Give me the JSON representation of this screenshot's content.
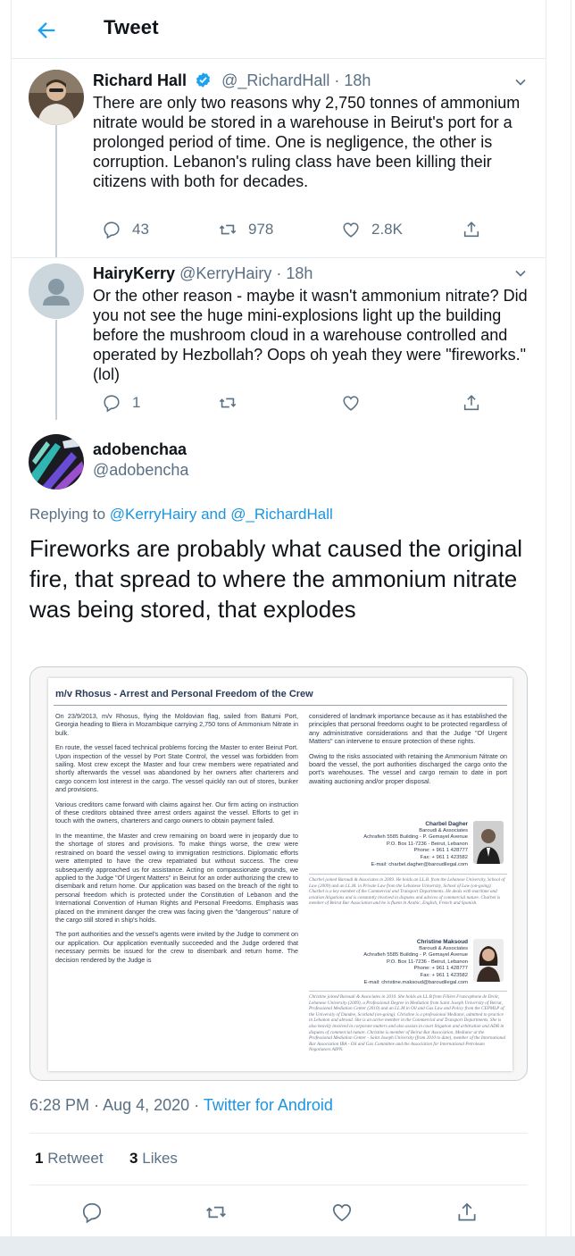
{
  "header": {
    "title": "Tweet",
    "back_icon": "arrow-left-icon"
  },
  "colors": {
    "accent": "#1b95e0",
    "text": "#0f1419",
    "muted": "#5b7083",
    "border": "#e6ecf0",
    "verified": "#1da1f2"
  },
  "tweet1": {
    "name": "Richard Hall",
    "handle": "@_RichardHall",
    "time": "· 18h",
    "verified": true,
    "text": "There are only two reasons why 2,750 tonnes of ammonium nitrate would be stored in a warehouse in Beirut's port for a prolonged period of time. One is negligence, the other is corruption. Lebanon's ruling class have been killing their citizens with both for decades.",
    "replies": "43",
    "retweets": "978",
    "likes": "2.8K"
  },
  "tweet2": {
    "name": "HairyKerry",
    "handle": "@KerryHairy",
    "time": "· 18h",
    "text": "Or the other reason - maybe it wasn't ammonium nitrate? Did you not see the huge mini-explosions light up the building before the mushroom cloud in a warehouse controlled and operated by Hezbollah? Oops oh yeah they were \"fireworks.\" (lol)",
    "replies": "1"
  },
  "main_tweet": {
    "name": "adobenchaa",
    "handle": "@adobencha",
    "replying_to_prefix": "Replying to",
    "replying_to_a": "@KerryHairy",
    "replying_to_and": "and",
    "replying_to_b": "@_RichardHall",
    "text": "Fireworks are probably what caused the original fire, that spread to where the ammonium nitrate was being stored, that explodes",
    "time": "6:28 PM",
    "dot": "·",
    "date": "Aug 4, 2020",
    "source": "Twitter for Android",
    "retweet_count": "1",
    "retweet_label": "Retweet",
    "like_count": "3",
    "like_label": "Likes"
  },
  "document": {
    "title": "m/v Rhosus - Arrest and Personal Freedom of the Crew",
    "left_paragraphs": [
      "On 23/9/2013, m/v Rhosus, flying the Moldovian flag, sailed from Batumi Port, Georgia heading to Biera in Mozambique carrying 2,750 tons of Ammonium Nitrate in bulk.",
      "En route, the vessel faced technical problems forcing the Master to enter Beirut Port. Upon inspection of the vessel by Port State Control, the vessel was forbidden from sailing. Most crew except the Master and four crew members were repatriated and shortly afterwards the vessel was abandoned by her owners after charterers and cargo concern lost interest in the cargo. The vessel quickly ran out of stores, bunker and provisions.",
      "Various creditors came forward with claims against her. Our firm acting on instruction of these creditors obtained three arrest orders against the vessel. Efforts to get in touch with the owners, charterers and cargo owners to obtain payment failed.",
      "In the meantime, the Master and crew remaining on board were in jeopardy due to the shortage of stores and provisions. To make things worse, the crew were restrained on board the vessel owing to immigration restrictions. Diplomatic efforts were attempted to have the crew repatriated but without success. The crew subsequently approached us for assistance. Acting on compassionate grounds, we applied to the Judge \"Of Urgent Matters\" in Beirut for an order authorizing the crew to disembark and return home. Our application was based on the breach of the right to personal freedom which is protected under the Constitution of Lebanon and the International Convention of Human Rights and Personal Freedoms. Emphasis was placed on the imminent danger the crew was facing given the \"dangerous\" nature of the cargo still stored in ship's holds.",
      "The port authorities and the vessel's agents were invited by the Judge to comment on our application. Our application eventually succeeded and the Judge ordered that necessary permits be issued for the crew to disembark and return home. The decision rendered by the Judge is"
    ],
    "right_paragraphs": [
      "considered of landmark importance because as it has established the principles that personal freedoms ought to be protected regardless of any administrative considerations and that the Judge \"Of Urgent Matters\" can intervene to ensure protection of these rights.",
      "Owing to the risks associated with retaining the Ammonium Nitrate on board the vessel, the port authorities discharged the cargo onto the port's warehouses. The vessel and cargo remain to date in port awaiting auctioning and/or proper disposal."
    ],
    "contact1": {
      "name": "Charbel Dagher",
      "lines": [
        "Baroudi & Associates",
        "Achrafieh 5585 Building - P. Gemayel Avenue",
        "P.O. Box 11-7236 - Beirut, Lebanon",
        "Phone: + 961 1 428777",
        "Fax: + 961 1 423582",
        "E-mail: charbel.dagher@baroudilegal.com"
      ]
    },
    "bio1": "Charbel joined Baroudi & Associates in 2009. He holds an LL.B. from the Lebanese University, School of Law (2009) and an LL.M. in Private Law from the Lebanese University, School of Law (on-going). Charbel is a key member of the Commercial and Transport Departments. He deals with maritime and aviation litigations and is constantly involved in disputes and advices of commercial nature. Charbel is member of Beirut Bar Association and he is fluent in Arabic, English, French and Spanish.",
    "contact2": {
      "name": "Christine Maksoud",
      "lines": [
        "Baroudi & Associates",
        "Achrafieh 5585 Building - P. Gemayel Avenue",
        "P.O. Box 11-7236 - Beirut, Lebanon",
        "Phone: + 961 1 428777",
        "Fax: + 961 1 423582",
        "E-mail: christine.maksoud@baroudilegal.com"
      ]
    },
    "bio2": "Christine joined Baroudi & Associates in 2010. She holds an LL.B from Filière Francophone de Droit, Lebanese University (2009), a Professional Degree in Mediation from Saint Joseph University of Beirut, Professional Mediation Center (2010) and an LL.M in Oil and Gas Law and Policy from the CEPMLP of the University of Dundee, Scotland (on-going). Christine is a professional Mediator, admitted to practice in Lebanon and abroad. She is an active member in the Commercial and Transport Departments. She is also heavily involved in corporate matters and also assists in court litigation and arbitration and ADR in disputes of commercial nature. Christine is member of Beirut Bar Association, Mediator at the Professional Mediation Center - Saint Joseph University (from 2010 to date), member of the International Bar Association IBA - Oil and Gas Committee and the Association for International Petroleum Negotiators AIPN."
  }
}
